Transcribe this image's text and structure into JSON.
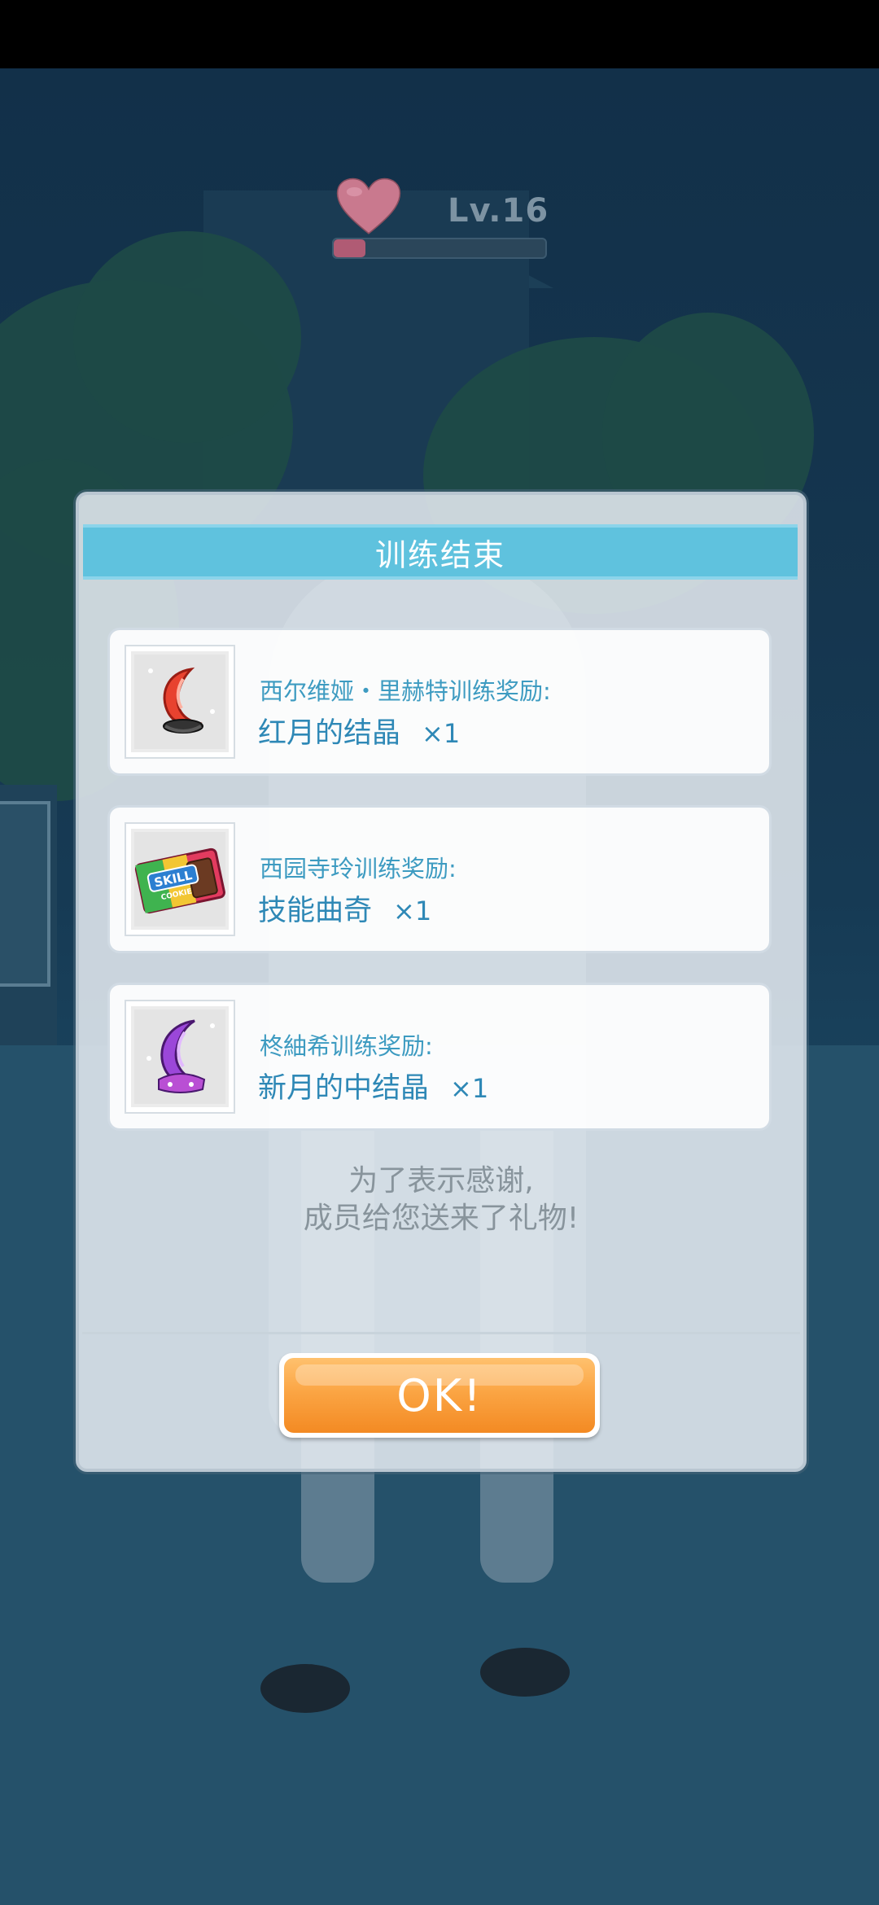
{
  "hud": {
    "level": "Lv.16",
    "affection_progress": 0.15
  },
  "dialog": {
    "title": "训练结束",
    "rewards": [
      {
        "title": "西尔维娅・里赫特训练奖励:",
        "item": "红月的结晶",
        "qty": "×1",
        "icon": "red-moon-crystal-icon"
      },
      {
        "title": "西园寺玲训练奖励:",
        "item": "技能曲奇",
        "qty": "×1",
        "icon": "skill-cookie-icon"
      },
      {
        "title": "柊紬希训练奖励:",
        "item": "新月的中结晶",
        "qty": "×1",
        "icon": "purple-moon-crystal-icon"
      }
    ],
    "thanks_line1": "为了表示感谢,",
    "thanks_line2": "成员给您送来了礼物!",
    "ok_label": "OK!"
  },
  "colors": {
    "header": "#5fc2de",
    "reward_text": "#2e88b6",
    "ok_button": "#f7962f",
    "heart": "#c9798e"
  }
}
